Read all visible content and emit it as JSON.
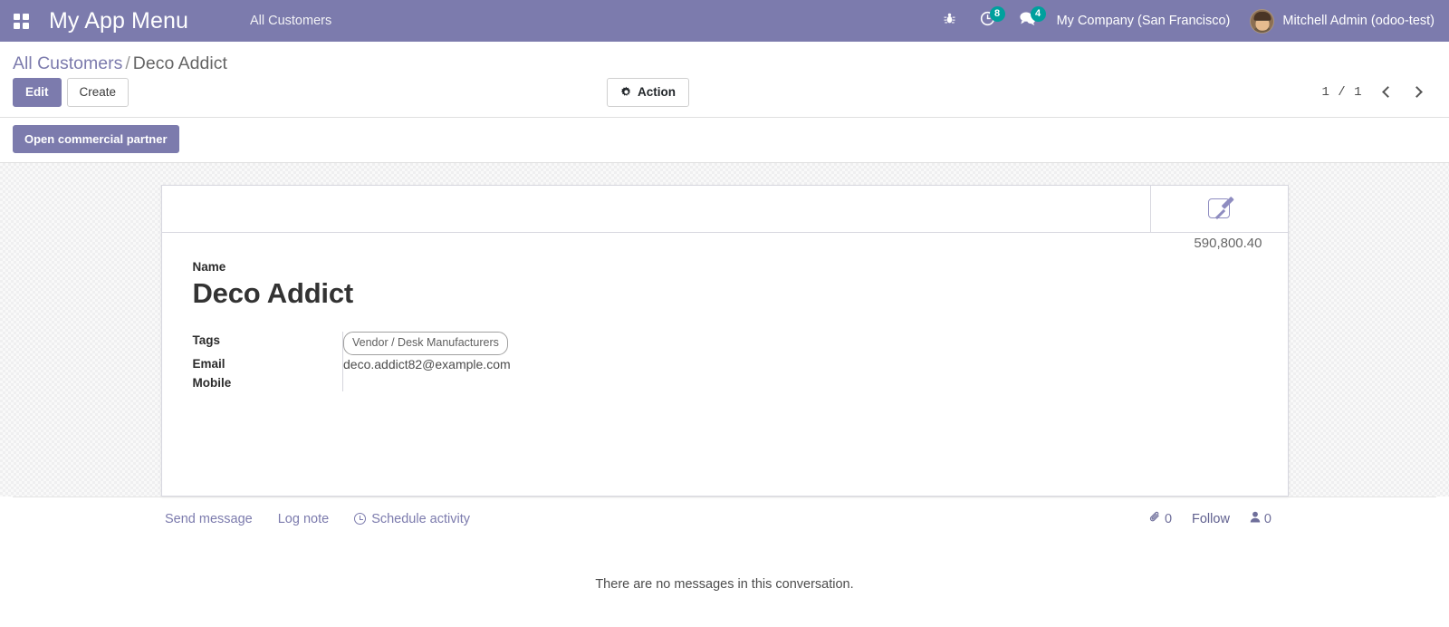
{
  "navbar": {
    "apps_icon": "apps-grid-icon",
    "brand": "My App Menu",
    "menu_item": "All Customers",
    "bug_icon": "bug-icon",
    "activity_icon": "clock-icon",
    "activity_count": "8",
    "messages_icon": "chat-bubble-icon",
    "messages_count": "4",
    "company": "My Company (San Francisco)",
    "user": "Mitchell Admin (odoo-test)",
    "avatar_icon": "avatar",
    "accent_color": "#7c7bad",
    "badge_color": "#00a09d"
  },
  "control_panel": {
    "breadcrumb_root": "All Customers",
    "breadcrumb_separator": "/",
    "breadcrumb_current": "Deco Addict",
    "edit_label": "Edit",
    "create_label": "Create",
    "action_label": "Action",
    "action_icon": "gear-icon",
    "pager_value": "1 / 1",
    "prev_icon": "chevron-left-icon",
    "next_icon": "chevron-right-icon"
  },
  "statusbar": {
    "open_commercial_partner": "Open commercial partner"
  },
  "form": {
    "stat_button_icon": "edit-square-icon",
    "stat_button_value": "590,800.40",
    "name_label": "Name",
    "record_title": "Deco Addict",
    "fields": [
      {
        "label": "Tags",
        "value": "Vendor / Desk Manufacturers",
        "kind": "tag"
      },
      {
        "label": "Email",
        "value": "deco.addict82@example.com",
        "kind": "text"
      },
      {
        "label": "Mobile",
        "value": "",
        "kind": "text"
      }
    ]
  },
  "chatter": {
    "send_message": "Send message",
    "log_note": "Log note",
    "schedule_activity": "Schedule activity",
    "schedule_icon": "clock-icon",
    "attachment_icon": "paperclip-icon",
    "attachment_count": "0",
    "follow_label": "Follow",
    "followers_icon": "person-icon",
    "followers_count": "0",
    "empty_message": "There are no messages in this conversation."
  }
}
